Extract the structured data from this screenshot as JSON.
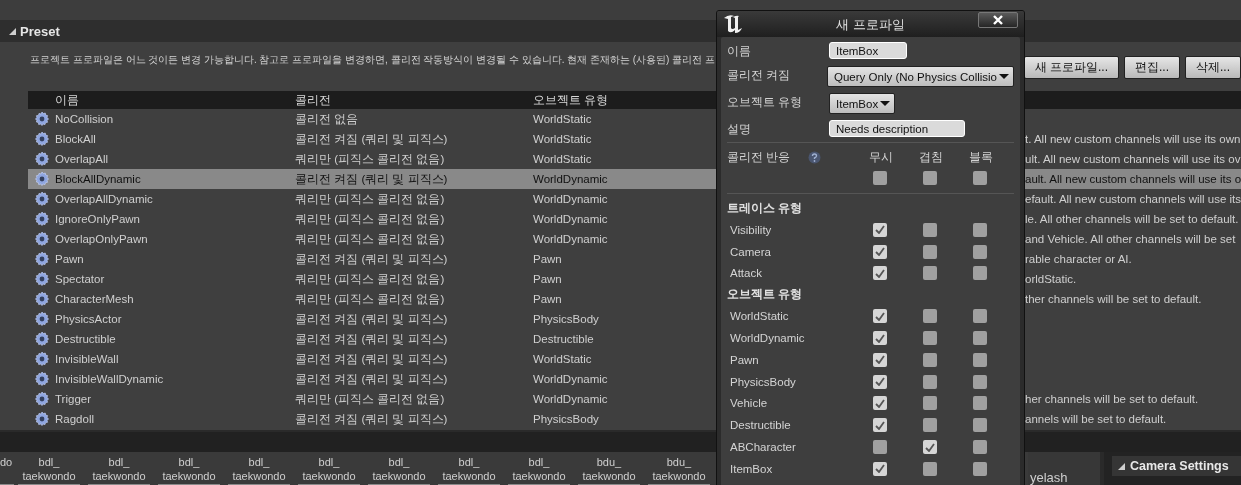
{
  "preset": {
    "title": "Preset",
    "expanded": true,
    "description": "프로젝트 프로파일은 어느 것이든 변경 가능합니다. 참고로 프로파일을 변경하면, 콜리전 작동방식이 변경될 수 있습니다. 현재 존재하는 (사용된) 콜리전 프",
    "buttons": [
      "새 프로파일...",
      "편집...",
      "삭제..."
    ],
    "columns": [
      "이름",
      "콜리전",
      "오브젝트 유형"
    ],
    "rows": [
      {
        "name": "NoCollision",
        "collision": "콜리전 없음",
        "object_type": "WorldStatic",
        "selected": false
      },
      {
        "name": "BlockAll",
        "collision": "콜리전 켜짐 (쿼리 및 피직스)",
        "object_type": "WorldStatic",
        "column_4": "t. All new custom channels will use its own",
        "selected": false
      },
      {
        "name": "OverlapAll",
        "collision": "쿼리만 (피직스 콜리전 없음)",
        "object_type": "WorldStatic",
        "column_4": "ult. All new custom channels will use its ov",
        "selected": false
      },
      {
        "name": "BlockAllDynamic",
        "collision": "콜리전 켜짐 (쿼리 및 피직스)",
        "object_type": "WorldDynamic",
        "column_4": "ault. All new custom channels will use its o",
        "selected": true
      },
      {
        "name": "OverlapAllDynamic",
        "collision": "쿼리만 (피직스 콜리전 없음)",
        "object_type": "WorldDynamic",
        "column_4": "efault. All new custom channels will use its",
        "selected": false
      },
      {
        "name": "IgnoreOnlyPawn",
        "collision": "쿼리만 (피직스 콜리전 없음)",
        "object_type": "WorldDynamic",
        "column_4": "le. All other channels will be set to default.",
        "selected": false
      },
      {
        "name": "OverlapOnlyPawn",
        "collision": "쿼리만 (피직스 콜리전 없음)",
        "object_type": "WorldDynamic",
        "column_4": "and Vehicle. All other channels will be set",
        "selected": false
      },
      {
        "name": "Pawn",
        "collision": "콜리전 켜짐 (쿼리 및 피직스)",
        "object_type": "Pawn",
        "column_4": "rable character or AI.",
        "selected": false
      },
      {
        "name": "Spectator",
        "collision": "쿼리만 (피직스 콜리전 없음)",
        "object_type": "Pawn",
        "column_4": "orldStatic.",
        "selected": false
      },
      {
        "name": "CharacterMesh",
        "collision": "쿼리만 (피직스 콜리전 없음)",
        "object_type": "Pawn",
        "column_4": "ther channels will be set to default.",
        "selected": false
      },
      {
        "name": "PhysicsActor",
        "collision": "콜리전 켜짐 (쿼리 및 피직스)",
        "object_type": "PhysicsBody",
        "selected": false
      },
      {
        "name": "Destructible",
        "collision": "콜리전 켜짐 (쿼리 및 피직스)",
        "object_type": "Destructible",
        "selected": false
      },
      {
        "name": "InvisibleWall",
        "collision": "콜리전 켜짐 (쿼리 및 피직스)",
        "object_type": "WorldStatic",
        "selected": false
      },
      {
        "name": "InvisibleWallDynamic",
        "collision": "콜리전 켜짐 (쿼리 및 피직스)",
        "object_type": "WorldDynamic",
        "selected": false
      },
      {
        "name": "Trigger",
        "collision": "쿼리만 (피직스 콜리전 없음)",
        "object_type": "WorldDynamic",
        "column_4": "her channels will be set to default.",
        "selected": false
      },
      {
        "name": "Ragdoll",
        "collision": "콜리전 켜짐 (쿼리 및 피직스)",
        "object_type": "PhysicsBody",
        "column_4": "annels will be set to default.",
        "selected": false
      }
    ]
  },
  "dialog": {
    "title": "새 프로파일",
    "fields": [
      {
        "kind": "text",
        "label": "이름",
        "value": "ItemBox"
      },
      {
        "kind": "dropdown",
        "label": "콜리전 켜짐",
        "value": "Query Only (No Physics Collisio"
      },
      {
        "kind": "dropdown",
        "label": "오브젝트 유형",
        "value": "ItemBox"
      },
      {
        "kind": "text",
        "label": "설명",
        "value": "Needs description"
      }
    ],
    "response_label": "콜리전 반응",
    "response_columns": [
      "무시",
      "겹침",
      "블록"
    ],
    "all_responses": [
      false,
      false,
      false
    ],
    "sections": [
      {
        "title": "트레이스 유형",
        "channels": [
          {
            "name": "Visibility",
            "responses": [
              true,
              false,
              false
            ]
          },
          {
            "name": "Camera",
            "responses": [
              true,
              false,
              false
            ]
          },
          {
            "name": "Attack",
            "responses": [
              true,
              false,
              false
            ]
          }
        ]
      },
      {
        "title": "오브젝트 유형",
        "channels": [
          {
            "name": "WorldStatic",
            "responses": [
              true,
              false,
              false
            ]
          },
          {
            "name": "WorldDynamic",
            "responses": [
              true,
              false,
              false
            ]
          },
          {
            "name": "Pawn",
            "responses": [
              true,
              false,
              false
            ]
          },
          {
            "name": "PhysicsBody",
            "responses": [
              true,
              false,
              false
            ]
          },
          {
            "name": "Vehicle",
            "responses": [
              true,
              false,
              false
            ]
          },
          {
            "name": "Destructible",
            "responses": [
              true,
              false,
              false
            ]
          },
          {
            "name": "ABCharacter",
            "responses": [
              false,
              true,
              false
            ]
          },
          {
            "name": "ItemBox",
            "responses": [
              true,
              false,
              false
            ]
          }
        ]
      }
    ]
  },
  "content_browser": {
    "items": [
      "do",
      "bdl_\ntaekwondo",
      "bdl_\ntaekwondo",
      "bdl_\ntaekwondo",
      "bdl_\ntaekwondo",
      "bdl_\ntaekwondo",
      "bdl_\ntaekwondo",
      "bdl_\ntaekwondo",
      "bdl_\ntaekwondo",
      "bdu_\ntaekwondo",
      "bdu_\ntaekwondo"
    ],
    "right_items": [
      "yelash"
    ]
  },
  "details": {
    "section": "Camera Settings",
    "expanded": true
  }
}
